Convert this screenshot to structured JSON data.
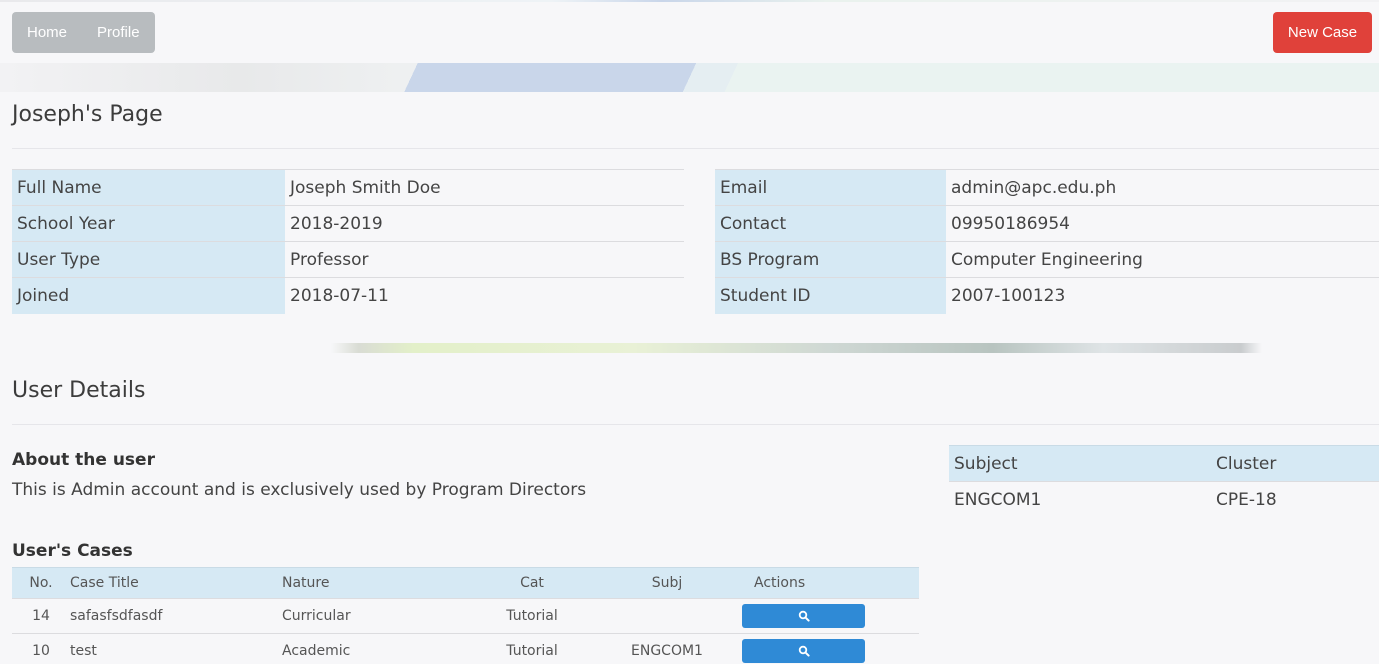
{
  "nav": {
    "home_label": "Home",
    "profile_label": "Profile",
    "new_case_label": "New Case"
  },
  "profile": {
    "title": "Joseph's Page",
    "left": [
      {
        "label": "Full Name",
        "value": "Joseph Smith Doe"
      },
      {
        "label": "School Year",
        "value": "2018-2019"
      },
      {
        "label": "User Type",
        "value": "Professor"
      },
      {
        "label": "Joined",
        "value": "2018-07-11"
      }
    ],
    "right": [
      {
        "label": "Email",
        "value": "admin@apc.edu.ph"
      },
      {
        "label": "Contact",
        "value": "09950186954"
      },
      {
        "label": "BS Program",
        "value": "Computer Engineering"
      },
      {
        "label": "Student ID",
        "value": "2007-100123"
      }
    ]
  },
  "details": {
    "title": "User Details",
    "about_heading": "About the user",
    "about_text": "This is Admin account and is exclusively used by Program Directors",
    "cases_heading": "User's Cases",
    "cases_columns": [
      "No.",
      "Case Title",
      "Nature",
      "Cat",
      "Subj",
      "Actions"
    ],
    "cases": [
      {
        "no": "14",
        "title": "safasfsdfasdf",
        "nature": "Curricular",
        "cat": "Tutorial",
        "subj": "",
        "action_icon": "search-icon"
      },
      {
        "no": "10",
        "title": "test",
        "nature": "Academic",
        "cat": "Tutorial",
        "subj": "ENGCOM1",
        "action_icon": "search-icon"
      }
    ],
    "subjects_columns": [
      "Subject",
      "Cluster"
    ],
    "subjects": [
      {
        "subject": "ENGCOM1",
        "cluster": "CPE-18"
      }
    ]
  },
  "colors": {
    "accent_blue": "#2f8ad6",
    "new_case_red": "#e0413a",
    "table_header": "#d6e9f4",
    "nav_gray": "#b8bcbf"
  }
}
